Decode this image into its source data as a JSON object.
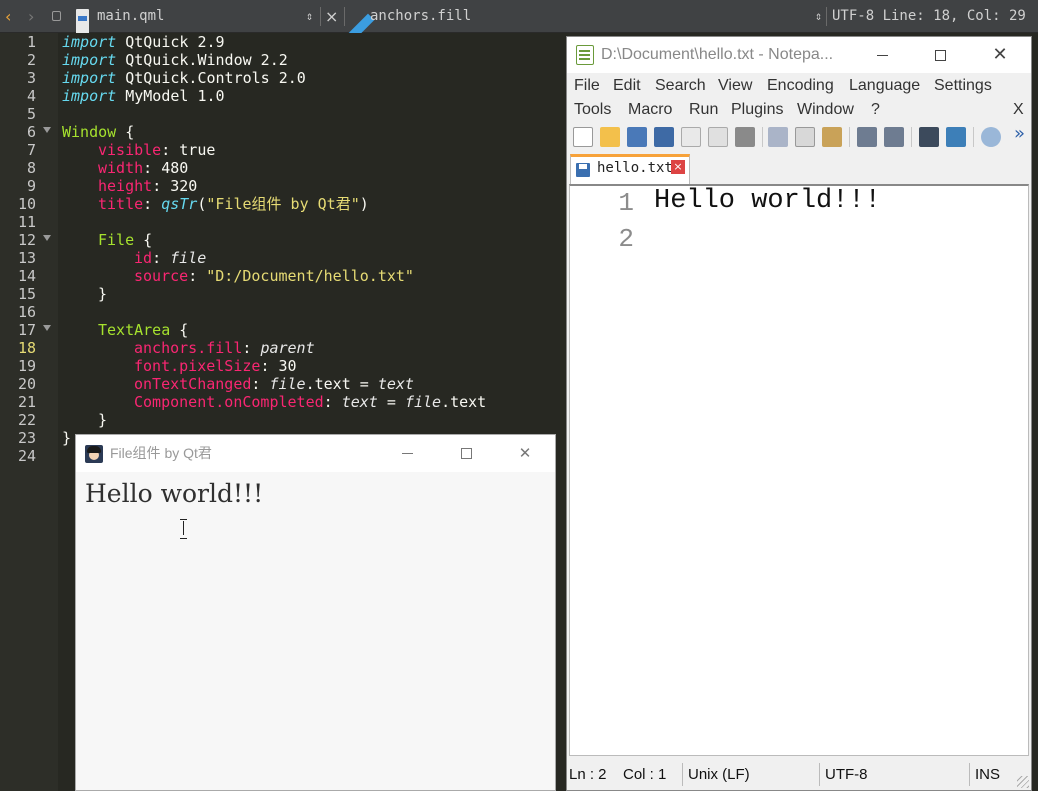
{
  "creator": {
    "topbar": {
      "file_name": "main.qml",
      "symbol": "anchors.fill",
      "encoding_position": "UTF-8 Line: 18, Col: 29",
      "close_glyph": "×",
      "back_glyph": "‹",
      "forward_glyph": "›",
      "updown_glyph": "⇕"
    },
    "line_numbers": [
      "1",
      "2",
      "3",
      "4",
      "5",
      "6",
      "7",
      "8",
      "9",
      "10",
      "11",
      "12",
      "13",
      "14",
      "15",
      "16",
      "17",
      "18",
      "19",
      "20",
      "21",
      "22",
      "23",
      "24"
    ],
    "current_line": 18,
    "code": {
      "import": "import",
      "mod1": "QtQuick 2.9",
      "mod2": "QtQuick.Window 2.2",
      "mod3": "QtQuick.Controls 2.0",
      "mod4": "MyModel 1.0",
      "window": "Window",
      "visible": "visible",
      "true": "true",
      "width": "width",
      "width_val": "480",
      "height": "height",
      "height_val": "320",
      "title": "title",
      "qstr": "qsTr",
      "title_str": "\"File组件 by Qt君\"",
      "file_type": "File",
      "id": "id",
      "file_id": "file",
      "source": "source",
      "source_str": "\"D:/Document/hello.txt\"",
      "textarea": "TextArea",
      "anchors_fill": "anchors.fill",
      "parent": "parent",
      "font_pixelsize": "font.pixelSize",
      "font_val": "30",
      "on_text_changed": "onTextChanged",
      "text": "text",
      "component_completed": "Component.onCompleted",
      "dot_text": ".text",
      "eq": " = ",
      "open_brace": " {",
      "close_brace": "}",
      "colon": ": "
    }
  },
  "qt_window": {
    "title": "File组件 by Qt君",
    "content": "Hello world!!!"
  },
  "notepad": {
    "title": "D:\\Document\\hello.txt - Notepa...",
    "menu_row1": [
      "File",
      "Edit",
      "Search",
      "View",
      "Encoding",
      "Language",
      "Settings"
    ],
    "menu_row2": [
      "Tools",
      "Macro",
      "Run",
      "Plugins",
      "Window",
      "?"
    ],
    "close_doc": "X",
    "more": "»",
    "tab_label": "hello.txt",
    "tab_close": "×",
    "lines": [
      {
        "num": "1",
        "text": "Hello world!!!"
      },
      {
        "num": "2",
        "text": ""
      }
    ],
    "status": {
      "ln": "Ln : 2",
      "col": "Col : 1",
      "eol": "Unix (LF)",
      "enc": "UTF-8",
      "mode": "INS"
    },
    "toolbar_icons": [
      "new-icon",
      "open-icon",
      "save-icon",
      "save-all-icon",
      "close-icon",
      "close-all-icon",
      "print-icon",
      "cut-icon",
      "copy-icon",
      "paste-icon",
      "undo-icon",
      "redo-icon",
      "find-icon",
      "replace-icon",
      "zoom-in-icon"
    ]
  },
  "window_controls": {
    "close": "✕"
  }
}
